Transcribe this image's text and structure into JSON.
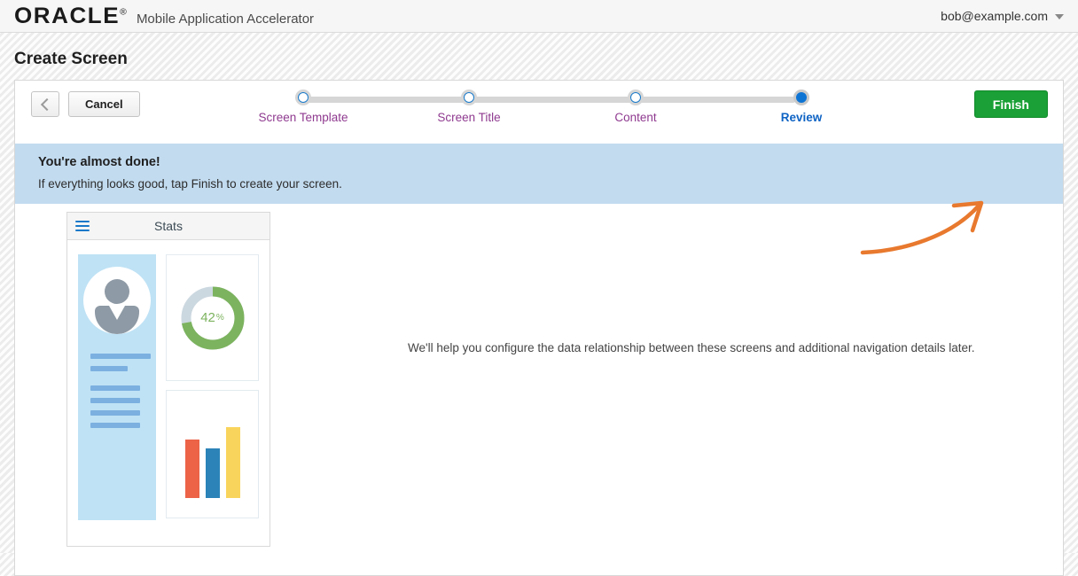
{
  "header": {
    "logo": "ORACLE",
    "logo_mark": "®",
    "app_name": "Mobile Application Accelerator",
    "user_email": "bob@example.com",
    "caret_icon": "chevron-down-icon"
  },
  "page": {
    "title": "Create Screen"
  },
  "toolbar": {
    "back_icon": "chevron-left-icon",
    "cancel_label": "Cancel",
    "finish_label": "Finish",
    "finish_color": "#1aa036"
  },
  "wizard": {
    "steps": [
      {
        "label": "Screen Template",
        "state": "complete"
      },
      {
        "label": "Screen Title",
        "state": "complete"
      },
      {
        "label": "Content",
        "state": "complete"
      },
      {
        "label": "Review",
        "state": "active"
      }
    ],
    "step_color": "#8f3a8f",
    "active_color": "#0e63c4"
  },
  "banner": {
    "title": "You're almost done!",
    "subtitle": "If everything looks good, tap Finish to create your screen.",
    "background": "#c2dbef"
  },
  "body": {
    "helper_text": "We'll help you configure the data relationship between these screens and additional navigation details later."
  },
  "mockup": {
    "menu_icon": "hamburger-menu-icon",
    "title": "Stats",
    "avatar_icon": "user-avatar-icon",
    "donut": {
      "value_label": "42",
      "unit_label": "%",
      "percent": 42,
      "arc_color": "#7cb35e",
      "track_color": "#ccd8e0"
    },
    "bars": [
      {
        "color": "#ec6348",
        "height": 66
      },
      {
        "color": "#2b83b8",
        "height": 56
      },
      {
        "color": "#f9d45c",
        "height": 80
      }
    ]
  },
  "annotation": {
    "arrow_icon": "curved-arrow-annotation",
    "color": "#e8792e"
  }
}
